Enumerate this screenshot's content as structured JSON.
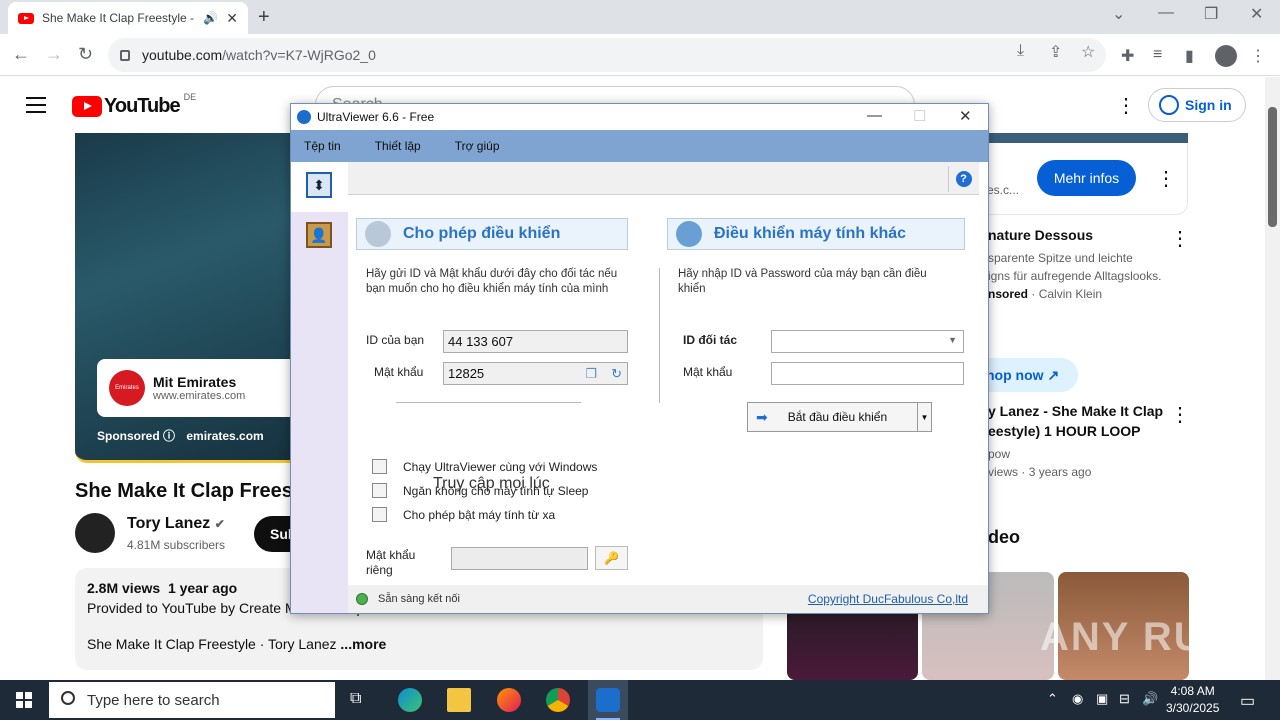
{
  "browser": {
    "tab_title": "She Make It Clap Freestyle -",
    "url_host": "youtube.com",
    "url_path": "/watch?v=K7-WjRGo2_0"
  },
  "youtube": {
    "logo_text": "YouTube",
    "region": "DE",
    "search_placeholder": "Search",
    "signin_label": "Sign in",
    "ad": {
      "advertiser": "Mit Emirates",
      "url": "www.emirates.com",
      "sponsored_label": "Sponsored",
      "domain": "emirates.com",
      "logo_text": "Emirates"
    },
    "video_title": "She Make It Clap Freest",
    "channel_name": "Tory Lanez",
    "subscribers": "4.81M subscribers",
    "subscribe_label": "Sub",
    "description": {
      "views": "2.8M views",
      "age": "1 year ago",
      "line2": "Provided to YouTube by Create Music Group",
      "line3": "She Make It Clap Freestyle · Tory Lanez",
      "more": "...more"
    },
    "sidebar": {
      "ad_site": "es.c...",
      "mehr_infos": "Mehr infos",
      "ad2_title": "nature Dessous",
      "ad2_line1": "sparente Spitze und leichte",
      "ad2_line2": "igns für aufregende Alltagslooks.",
      "ad2_sponsor": "nsored",
      "ad2_brand": "Calvin Klein",
      "shop_now": "hop now",
      "rec_title1": "y Lanez - She Make It Clap",
      "rec_title2": "eestyle) 1 HOUR LOOP",
      "rec_channel": "pow",
      "rec_views": "views",
      "rec_age": "3 years ago",
      "section": "deo"
    }
  },
  "ultraviewer": {
    "title": "UltraViewer 6.6 - Free",
    "menu": [
      "Tệp tin",
      "Thiết lập",
      "Trợ giúp"
    ],
    "allow_header": "Cho phép điều khiển",
    "allow_desc": "Hãy gửi ID và Mật khẩu dưới đây cho đối tác nếu bạn muốn cho họ điều khiển máy tính của mình",
    "id_label": "ID của bạn",
    "id_value": "44 133 607",
    "pw_label": "Mật khẩu",
    "pw_value": "12825",
    "access_title": "Truy cập mọi lúc",
    "options": [
      "Chạy UltraViewer cùng với Windows",
      "Ngăn không cho máy tính tự Sleep",
      "Cho phép bật máy tính từ xa"
    ],
    "private_pw_label": "Mật khẩu riêng",
    "control_header": "Điều khiển máy tính khác",
    "control_desc": "Hãy nhập ID và Password của máy bạn cần điều khiển",
    "partner_id_label": "ID đối tác",
    "partner_pw_label": "Mật khẩu",
    "connect_label": "Bắt đầu điều khiển",
    "status": "Sẵn sàng kết nối",
    "copyright": "Copyright DucFabulous Co,ltd"
  },
  "watermark": "ANY RUN",
  "taskbar": {
    "search_placeholder": "Type here to search",
    "time": "4:08 AM",
    "date": "3/30/2025"
  }
}
